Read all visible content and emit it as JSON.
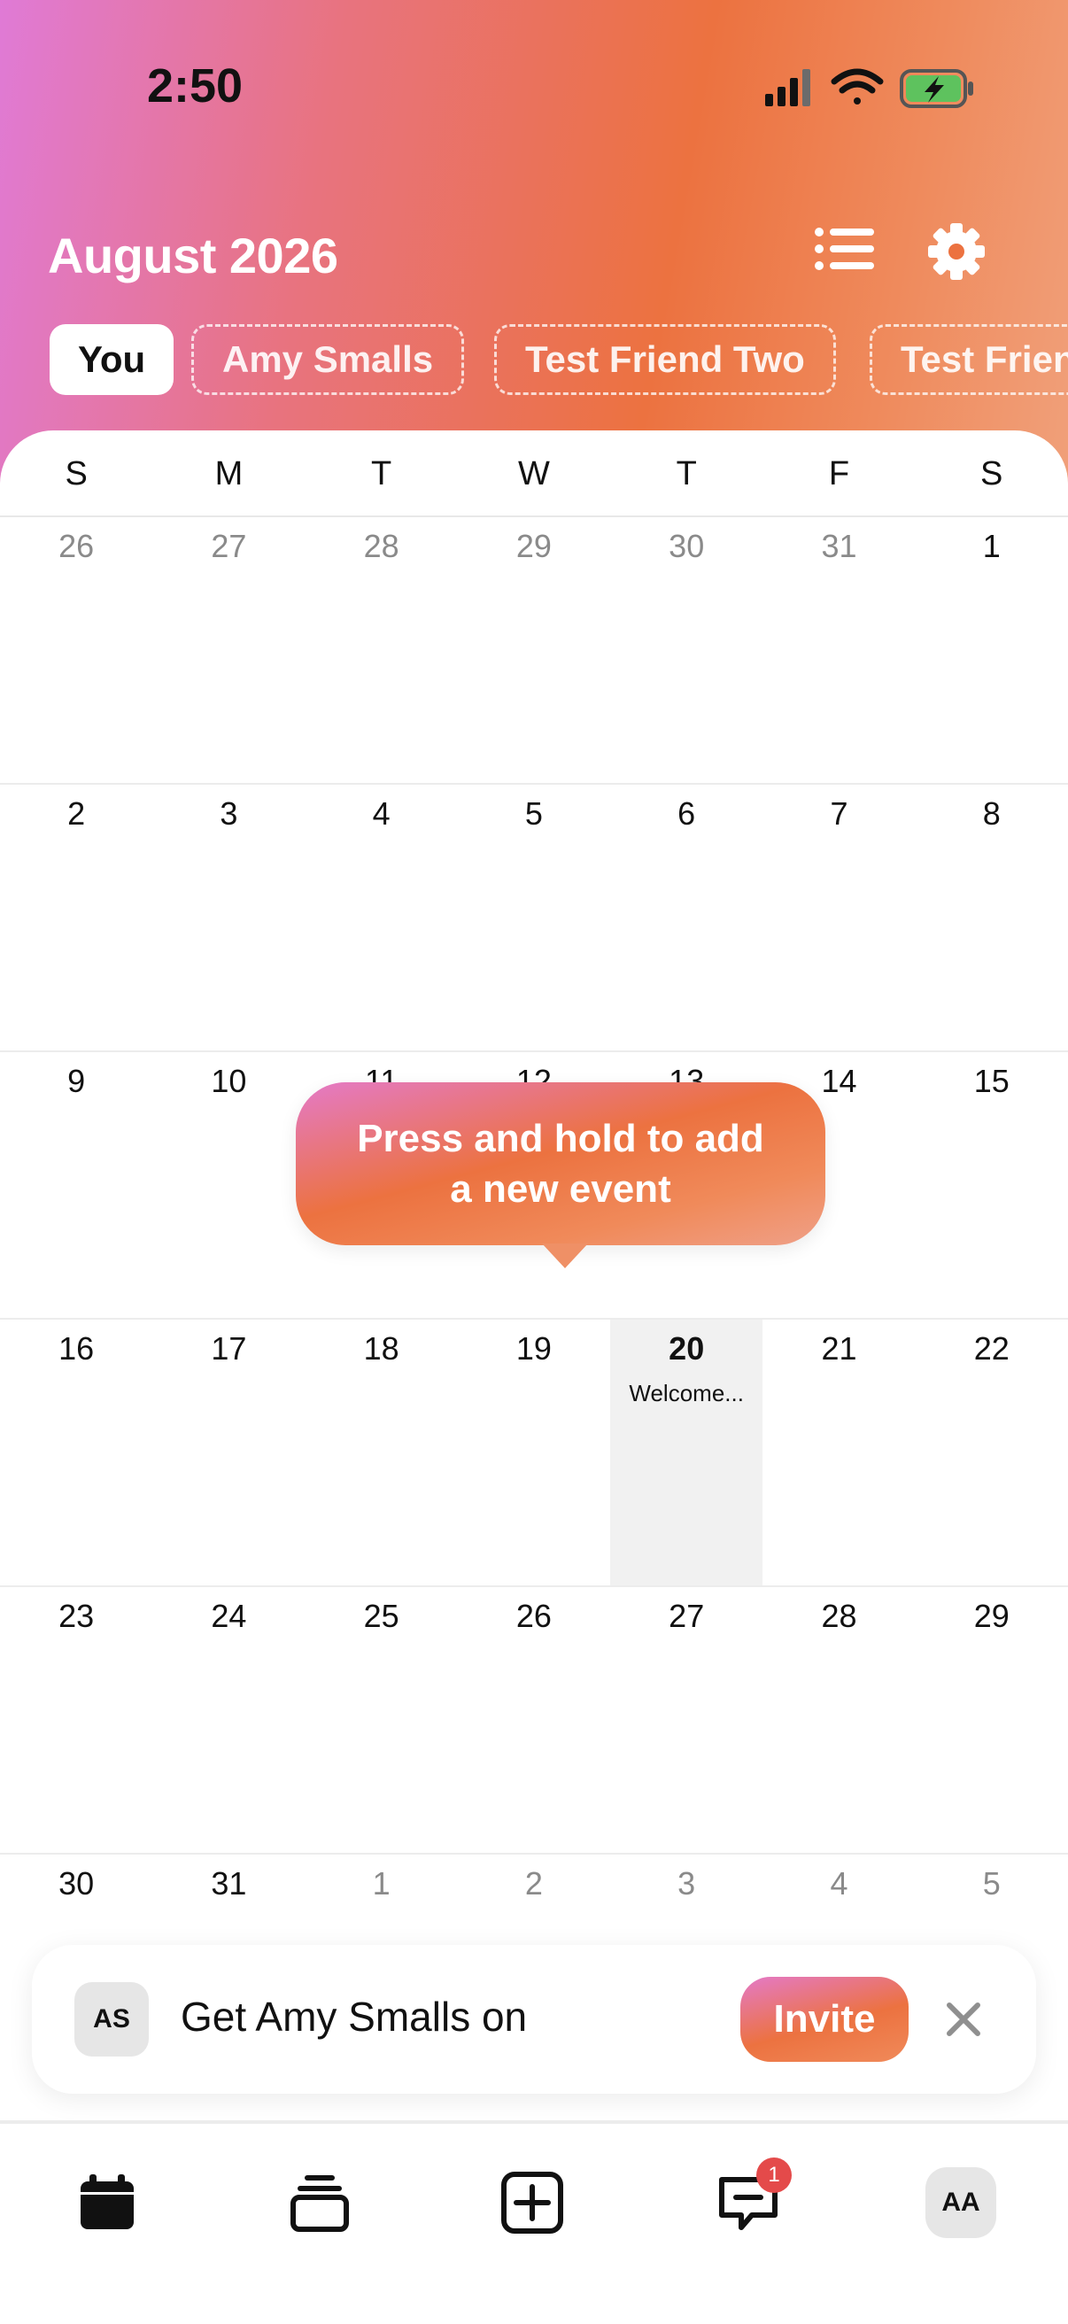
{
  "status_bar": {
    "time": "2:50"
  },
  "header": {
    "month_title": "August 2026"
  },
  "people_chips": [
    {
      "label": "You",
      "active": true
    },
    {
      "label": "Amy Smalls",
      "active": false
    },
    {
      "label": "Test Friend Two",
      "active": false
    },
    {
      "label": "Test Frien",
      "active": false
    }
  ],
  "weekdays": [
    "S",
    "M",
    "T",
    "W",
    "T",
    "F",
    "S"
  ],
  "weeks": [
    [
      {
        "d": "26",
        "muted": true
      },
      {
        "d": "27",
        "muted": true
      },
      {
        "d": "28",
        "muted": true
      },
      {
        "d": "29",
        "muted": true
      },
      {
        "d": "30",
        "muted": true
      },
      {
        "d": "31",
        "muted": true
      },
      {
        "d": "1"
      }
    ],
    [
      {
        "d": "2"
      },
      {
        "d": "3"
      },
      {
        "d": "4"
      },
      {
        "d": "5"
      },
      {
        "d": "6"
      },
      {
        "d": "7"
      },
      {
        "d": "8"
      }
    ],
    [
      {
        "d": "9"
      },
      {
        "d": "10"
      },
      {
        "d": "11"
      },
      {
        "d": "12"
      },
      {
        "d": "13"
      },
      {
        "d": "14"
      },
      {
        "d": "15"
      }
    ],
    [
      {
        "d": "16"
      },
      {
        "d": "17"
      },
      {
        "d": "18"
      },
      {
        "d": "19"
      },
      {
        "d": "20",
        "today": true,
        "event": "Welcome..."
      },
      {
        "d": "21"
      },
      {
        "d": "22"
      }
    ],
    [
      {
        "d": "23"
      },
      {
        "d": "24"
      },
      {
        "d": "25"
      },
      {
        "d": "26"
      },
      {
        "d": "27"
      },
      {
        "d": "28"
      },
      {
        "d": "29"
      }
    ],
    [
      {
        "d": "30"
      },
      {
        "d": "31"
      },
      {
        "d": "1",
        "muted": true
      },
      {
        "d": "2",
        "muted": true
      },
      {
        "d": "3",
        "muted": true
      },
      {
        "d": "4",
        "muted": true
      },
      {
        "d": "5",
        "muted": true
      }
    ]
  ],
  "tooltip": {
    "line1": "Press and hold to add",
    "line2": "a new event"
  },
  "invite_card": {
    "avatar_initials": "AS",
    "text": "Get Amy Smalls on",
    "button_label": "Invite"
  },
  "tab_bar": {
    "messages_badge": "1",
    "profile_initials": "AA",
    "icons": [
      "calendar-icon",
      "stack-icon",
      "add-square-icon",
      "messages-icon",
      "profile-avatar"
    ]
  },
  "colors": {
    "gradient_pink": "#e07ad6",
    "gradient_orange": "#ec7240",
    "badge_red": "#e44a4a",
    "today_bg": "#f1f1f1"
  }
}
